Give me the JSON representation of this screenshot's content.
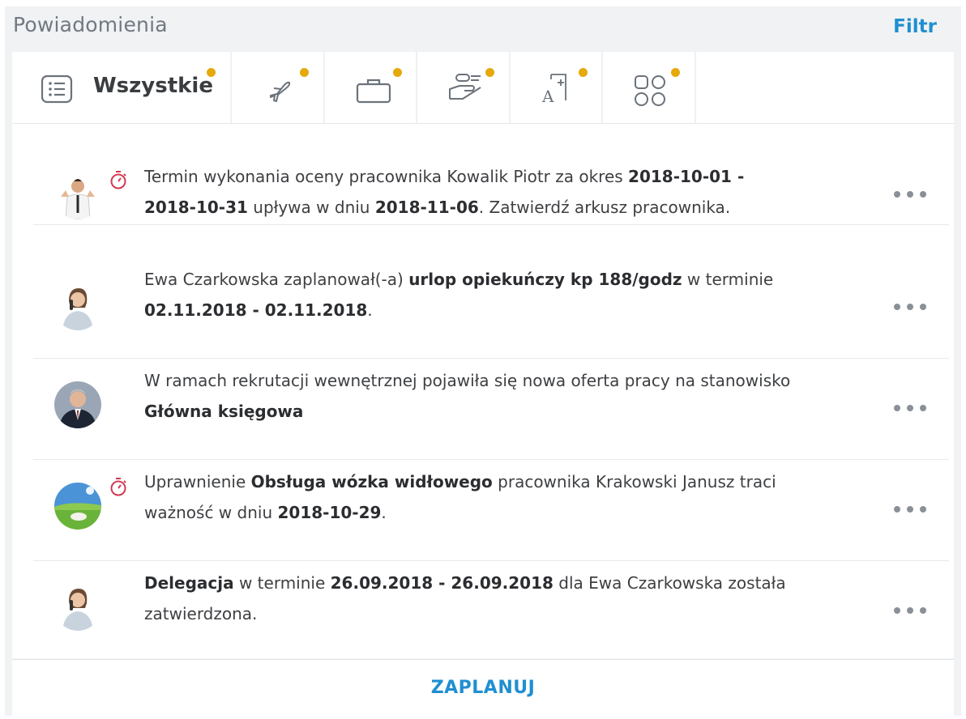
{
  "header": {
    "title": "Powiadomienia",
    "filter_label": "Filtr"
  },
  "tabs": [
    {
      "label": "Wszystkie",
      "icon": "list-icon",
      "has_badge": true
    },
    {
      "icon": "plane-icon",
      "has_badge": true
    },
    {
      "icon": "briefcase-icon",
      "has_badge": true
    },
    {
      "icon": "hand-money-icon",
      "has_badge": true
    },
    {
      "icon": "grade-icon",
      "has_badge": true
    },
    {
      "icon": "apps-grid-icon",
      "has_badge": true
    }
  ],
  "notifications": [
    {
      "avatar": "man-thumbs-up",
      "has_timer": true,
      "parts": [
        {
          "t": "Termin wykonania oceny pracownika Kowalik Piotr za okres "
        },
        {
          "t": "2018-10-01 - 2018-10-31",
          "b": true
        },
        {
          "t": " upływa w dniu "
        },
        {
          "t": "2018-11-06",
          "b": true
        },
        {
          "t": ". Zatwierdź arkusz pracownika."
        }
      ]
    },
    {
      "avatar": "woman-phone",
      "has_timer": false,
      "parts": [
        {
          "t": "Ewa Czarkowska zaplanował(-a) "
        },
        {
          "t": "urlop opiekuńczy kp 188/godz",
          "b": true
        },
        {
          "t": " w terminie "
        },
        {
          "t": "02.11.2018 - 02.11.2018",
          "b": true
        },
        {
          "t": "."
        }
      ]
    },
    {
      "avatar": "man-suit",
      "has_timer": false,
      "parts": [
        {
          "t": "W ramach rekrutacji wewnętrznej pojawiła się nowa oferta pracy na stanowisko "
        },
        {
          "t": "Główna księgowa",
          "b": true
        }
      ]
    },
    {
      "avatar": "landscape",
      "has_timer": true,
      "parts": [
        {
          "t": "Uprawnienie "
        },
        {
          "t": "Obsługa wózka widłowego",
          "b": true
        },
        {
          "t": " pracownika Krakowski Janusz traci ważność w dniu "
        },
        {
          "t": "2018-10-29",
          "b": true
        },
        {
          "t": "."
        }
      ]
    },
    {
      "avatar": "woman-phone",
      "has_timer": false,
      "parts": [
        {
          "t": "Delegacja",
          "b": true
        },
        {
          "t": " w terminie "
        },
        {
          "t": "26.09.2018 - 26.09.2018",
          "b": true
        },
        {
          "t": " dla Ewa Czarkowska została zatwierdzona."
        }
      ]
    }
  ],
  "footer": {
    "plan_label": "ZAPLANUJ"
  },
  "colors": {
    "accent": "#1f8fd1",
    "badge": "#e5a90b",
    "timer": "#d23a52",
    "panel_bg": "#f1f2f4"
  }
}
